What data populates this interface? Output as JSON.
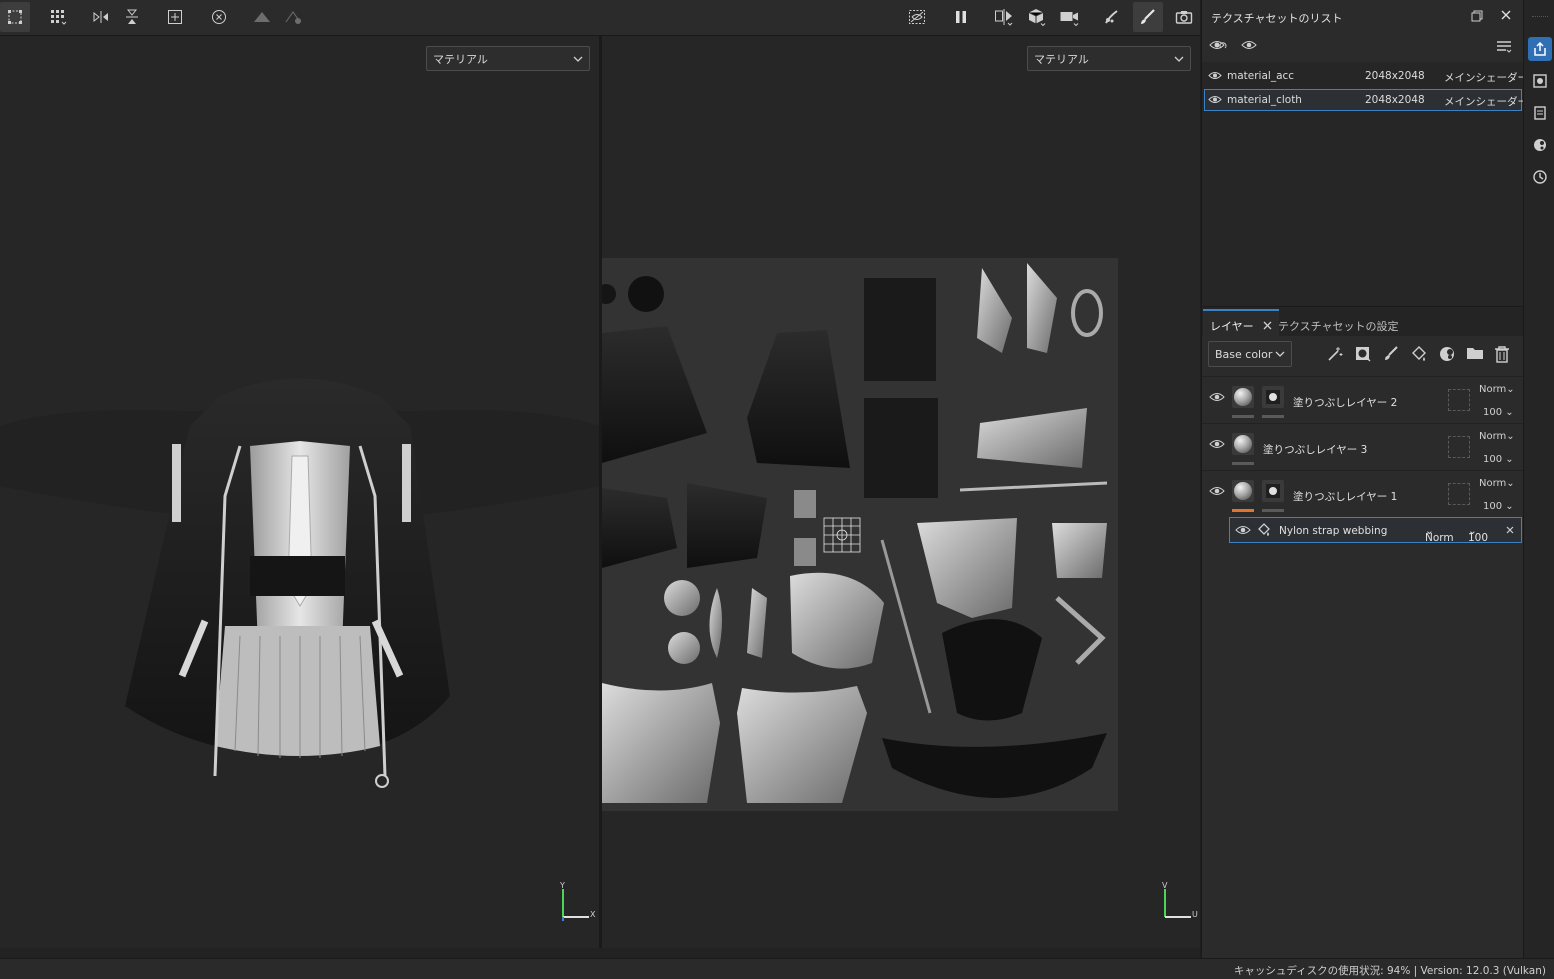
{
  "toolbar": {
    "left_icons": [
      "selection-mode-icon",
      "grid-select-icon",
      "mirror-x-icon",
      "mirror-y-icon",
      "frame-add-icon",
      "history-reset-icon",
      "symmetry-icon",
      "symmetry-settings-icon"
    ],
    "right_icons": [
      "hide-uv-icon",
      "pause-icon",
      "split-view-icon",
      "cube-icon",
      "camera-icon",
      "smudge-icon",
      "brush-icon",
      "screenshot-icon"
    ]
  },
  "viewport3d": {
    "material_select": "マテリアル",
    "gizmo": {
      "y": "Y",
      "x": "X"
    }
  },
  "viewport2d": {
    "material_select": "マテリアル",
    "gizmo": {
      "v": "V",
      "u": "U"
    }
  },
  "texture_set_list": {
    "title": "テクスチャセットのリスト",
    "rows": [
      {
        "name": "material_acc",
        "resolution": "2048x2048",
        "shader": "メインシェーダー",
        "selected": false
      },
      {
        "name": "material_cloth",
        "resolution": "2048x2048",
        "shader": "メインシェーダー",
        "selected": true
      }
    ]
  },
  "layers_panel": {
    "tabs": [
      {
        "label": "レイヤー",
        "active": true
      },
      {
        "label": "テクスチャセットの設定",
        "active": false
      }
    ],
    "channel": "Base color",
    "layers": [
      {
        "name": "塗りつぶしレイヤー 2",
        "blend": "Norm",
        "opacity": "100",
        "has_mask": true,
        "accent": "#5a5a5a"
      },
      {
        "name": "塗りつぶしレイヤー 3",
        "blend": "Norm",
        "opacity": "100",
        "has_mask": false,
        "accent": "#5a5a5a"
      },
      {
        "name": "塗りつぶしレイヤー 1",
        "blend": "Norm",
        "opacity": "100",
        "has_mask": true,
        "accent": "#e0762e"
      }
    ],
    "effect": {
      "name": "Nylon strap webbing",
      "blend": "Norm",
      "opacity": "100"
    }
  },
  "status": {
    "text": "キャッシュディスクの使用状況:   94% | Version: 12.0.3 (Vulkan)"
  },
  "colors": {
    "accent": "#3b82c4",
    "active_side": "#2f6fb4",
    "fill_layer": "#e0762e"
  }
}
